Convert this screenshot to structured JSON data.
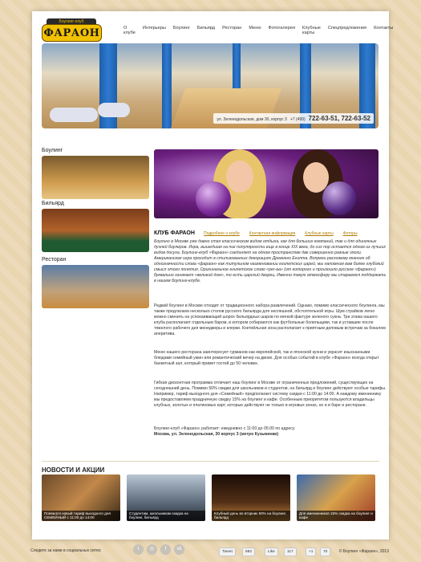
{
  "logo": {
    "top_text": "Боулинг-клуб",
    "name": "ФАРАОН"
  },
  "nav": {
    "items": [
      "О клубе",
      "Интерьеры",
      "Боулинг",
      "Бильярд",
      "Ресторан",
      "Меню",
      "Фотогалерея",
      "Клубные карты",
      "Спецпредложения",
      "Контакты"
    ]
  },
  "hero": {
    "address": "ул. Зеленодольская, дом 30, корпус 3",
    "phone_prefix": "+7 (499)",
    "phone_numbers": "722-63-51, 722-63-52"
  },
  "sidebar": {
    "items": [
      {
        "label": "Боулинг"
      },
      {
        "label": "Бильярд"
      },
      {
        "label": "Ресторан"
      }
    ]
  },
  "content": {
    "title": "КЛУБ ФАРАОН",
    "sublinks": [
      "Подробнее о клубе",
      "Контактная информация",
      "Клубные карты",
      "Фоторы"
    ],
    "intro": "Боулинг в Москве уже давно стал классическим видом отдыха, как для больших компаний, так и для одиночных дуэлей боулеров. Игра, вышедшая на пик популярности еще в конце XIX века, до сих пор остается одним из лучших видов досуга. Боулинг-клуб «Фараон» соединяет на одном пространстве две совершенно разные эпохи. Американская игра проходит в стилизованных декорациях Древнего Египта. Вопреки расхожему мнению об однозначности слова «фараон» как титульном наименовании египетских царей, мы напомним вам более глубокий смысл этого понятия. Оригинальное египетское слово «per-aa» (от которого и произошло русское «фараон») буквально означает «великий дом», то есть царский дворец. Именно такую атмосферу мы стараемся поддержать в нашем боулинг-клубе.",
    "para1": "Редкий боулинг в Москве отходит от традиционного набора развлечений. Однако, помимо классического боулинга, мы также предлагаем несколько столов русского бильярда для неспешной, обстоятельной игры. Шум страйков легко можно сменить на успокаивающий шорох бильярдных шаров по мягкой фактуре зеленого сукна. Три этажа нашего клуба располагают отдельным баром, в котором собираются как футбольные болельщики, так и уставшие после тяжелого рабочего дня менеджеры и клерки. Коктейльная зона располагает к приятным деловым встречам за бокалом аперитива.",
    "para2": "Меню нашего ресторана заинтересует гурманов как европейской, так и японской кухни и украсит изысканными блюдами семейный ужин или романтический вечер на двоих. Для особых событий в клубе «Фараон» всегда открыт банкетный зал, который примет гостей до 50 человек.",
    "para3": "Гибкая дисконтная программа отличает наш боулинг в Москве от ограниченных предложений, существующих на сегодняшний день. Помимо 50% скидки для школьников и студентов, на бильярд и боулинг действуют особые тарифы. Например, тариф выходного дня «Семейный» предполагает систему скидки с 11:00 до 14:00. А каждому имениннику мы предоставляем праздничную скидку 15% на боулинг и кафе. Особенным приоритетом пользуются владельцы клубных, золотых и платиновых карт, которые действуют не только в игровых зонах, но и в баре и ресторане.",
    "hours": "Боулинг-клуб «Фараон» работает: ежедневно с 11:00 до 05:00 по адресу",
    "address_bold": "Москва, ул. Зеленодольская, 30 корпус 3 (метро Кузьминки)"
  },
  "news": {
    "title": "НОВОСТИ И АКЦИИ",
    "items": [
      {
        "caption": "Появился новый тариф выходного дня СЕМЕЙНЫЙ с 11:00 до 14:00"
      },
      {
        "caption": "Студентам, школьникам скидка на боулинг, бильярд"
      },
      {
        "caption": "Клубный день во вторник 50% на боулинг, бильярд"
      },
      {
        "caption": "Для именинников 15% скидка на боулинг и кафе"
      }
    ]
  },
  "footer": {
    "social_label": "Следите за нами в социальных сетях:",
    "tweet_label": "Tweet",
    "tweet_count": "692",
    "like_label": "Like",
    "like_count": "117",
    "plus_count": "70",
    "copyright": "© Боулинг «Фараон», 2013"
  }
}
